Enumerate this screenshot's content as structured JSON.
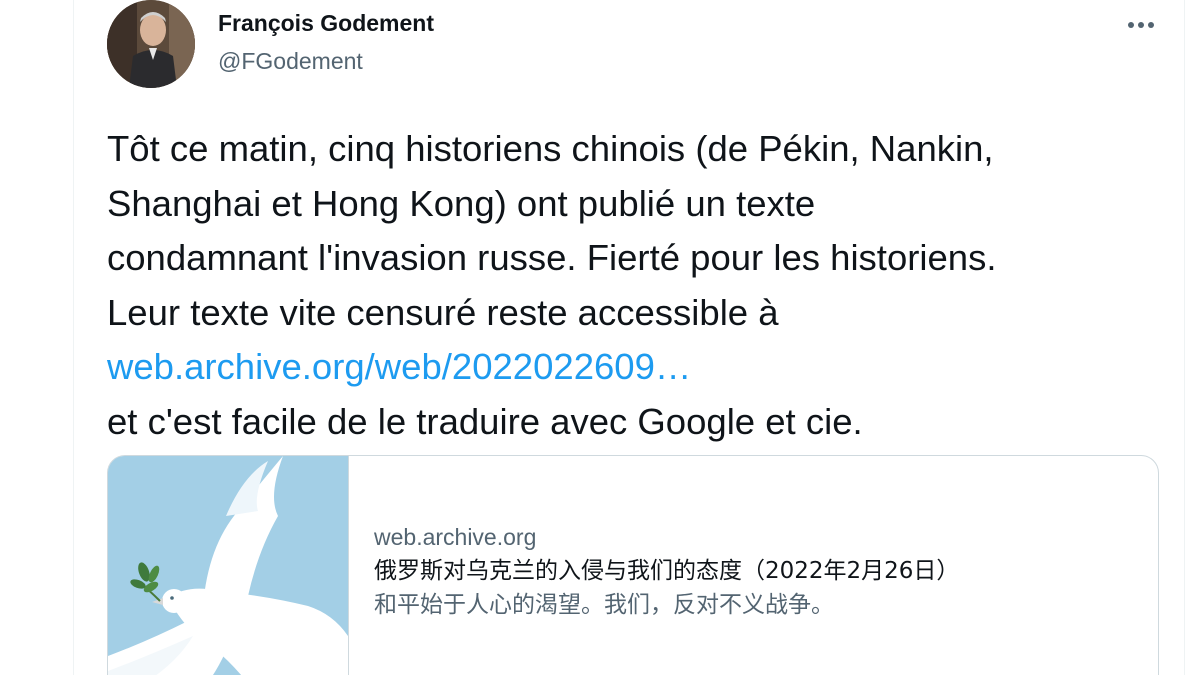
{
  "author": {
    "name": "François Godement",
    "handle": "@FGodement"
  },
  "tweet": {
    "line1": "Tôt ce matin, cinq historiens chinois (de Pékin, Nankin,",
    "line2": "Shanghai et Hong Kong) ont publié un texte",
    "line3": "condamnant l'invasion russe. Fierté pour les historiens.",
    "line4": "Leur texte vite censuré reste accessible à",
    "link_text": "web.archive.org/web/2022022609…",
    "line6": "et c'est facile de le traduire avec Google et cie."
  },
  "link_card": {
    "domain": "web.archive.org",
    "title": "俄罗斯对乌克兰的入侵与我们的态度（2022年2月26日）",
    "description": "和平始于人心的渴望。我们，反对不义战争。",
    "image_icon": "white-dove-with-olive-branch"
  },
  "icons": {
    "more": "more-options-icon"
  },
  "colors": {
    "link": "#1d9bf0",
    "text": "#0f1419",
    "secondary": "#536471",
    "card_image_bg": "#a3cfe6"
  }
}
